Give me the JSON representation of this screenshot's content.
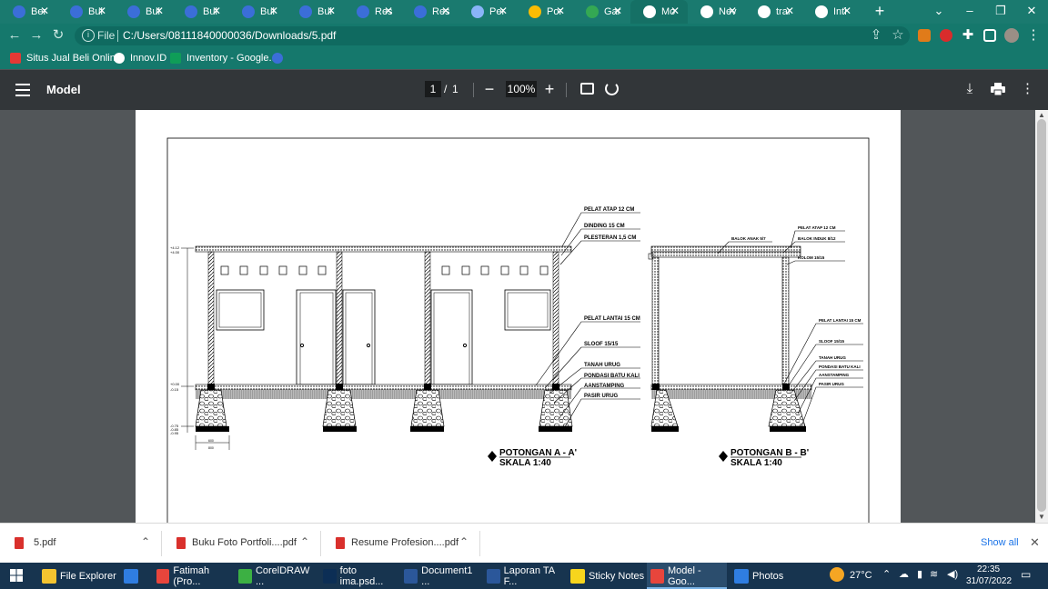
{
  "tabs": [
    {
      "title": "Ber",
      "color": "#3b6ed8"
    },
    {
      "title": "Bul",
      "color": "#3b6ed8"
    },
    {
      "title": "Bul",
      "color": "#3b6ed8"
    },
    {
      "title": "Bul",
      "color": "#3b6ed8"
    },
    {
      "title": "Bul",
      "color": "#3b6ed8"
    },
    {
      "title": "Bul",
      "color": "#3b6ed8"
    },
    {
      "title": "Res",
      "color": "#3b6ed8"
    },
    {
      "title": "Res",
      "color": "#3b6ed8"
    },
    {
      "title": "Per",
      "color": "#8ab4f8"
    },
    {
      "title": "Por",
      "color": "#fbbc04"
    },
    {
      "title": "Gar",
      "color": "#34a853"
    },
    {
      "title": "Mo",
      "color": "#ffffff"
    },
    {
      "title": "Nev",
      "color": "#ffffff"
    },
    {
      "title": "trar",
      "color": "#ffffff"
    },
    {
      "title": "Inti",
      "color": "#ffffff"
    }
  ],
  "address": {
    "scheme_label": "File",
    "url": "C:/Users/08111840000036/Downloads/5.pdf"
  },
  "bookmarks": [
    {
      "label": "Situs Jual Beli Onlin...",
      "color": "#e53935"
    },
    {
      "label": "Innov.ID",
      "color": "#ffffff"
    },
    {
      "label": "Inventory - Google...",
      "color": "#0f9d58"
    },
    {
      "label": "",
      "color": "#3b6ed8"
    }
  ],
  "pdf": {
    "title": "Model",
    "page_current": "1",
    "page_sep": "/",
    "page_total": "1",
    "zoom": "100%"
  },
  "drawing": {
    "section_a": {
      "title": "POTONGAN A - A'",
      "scale": "SKALA 1:40"
    },
    "section_b": {
      "title": "POTONGAN B - B'",
      "scale": "SKALA 1:40"
    },
    "labels_a": [
      "PELAT ATAP 12 CM",
      "DINDING 15 CM",
      "PLESTERAN 1,5 CM",
      "PELAT LANTAI 15 CM",
      "SLOOF 15/15",
      "TANAH URUG",
      "PONDASI BATU KALI",
      "AANSTAMPING",
      "PASIR URUG"
    ],
    "labels_b": [
      "PELAT ATAP 12 CM",
      "BALOK ANAK 5/7",
      "BALOK INDUK 8/12",
      "KOLOM 15/15",
      "PELAT LANTAI 15 CM",
      "SLOOF 15/15",
      "TANAH URUG",
      "PONDASI BATU KALI",
      "AANSTAMPING",
      "PASIR URUG"
    ],
    "levels": [
      "+4.12",
      "+4.00",
      "+0.00",
      "-0.15",
      "-0.75",
      "-0.85",
      "-0.95"
    ],
    "dims": [
      "600",
      "800"
    ]
  },
  "downloads": [
    {
      "name": "5.pdf"
    },
    {
      "name": "Buku Foto Portfoli....pdf"
    },
    {
      "name": "Resume Profesion....pdf"
    }
  ],
  "show_all": "Show all",
  "taskbar": [
    {
      "label": "File Explorer",
      "color": "#f4c430"
    },
    {
      "label": "",
      "color": "#2f7de1"
    },
    {
      "label": "Fatimah (Pro...",
      "color": "#e8453c"
    },
    {
      "label": "CorelDRAW ...",
      "color": "#3cb043"
    },
    {
      "label": "foto ima.psd...",
      "color": "#0c2e55"
    },
    {
      "label": "Document1 ...",
      "color": "#2b579a"
    },
    {
      "label": "Laporan TA F...",
      "color": "#2b579a"
    },
    {
      "label": "Sticky Notes",
      "color": "#f7d51d"
    },
    {
      "label": "Model - Goo...",
      "color": "#e8453c"
    },
    {
      "label": "Photos",
      "color": "#2f7de1"
    }
  ],
  "tray": {
    "temp": "27°C",
    "time": "22:35",
    "date": "31/07/2022"
  }
}
